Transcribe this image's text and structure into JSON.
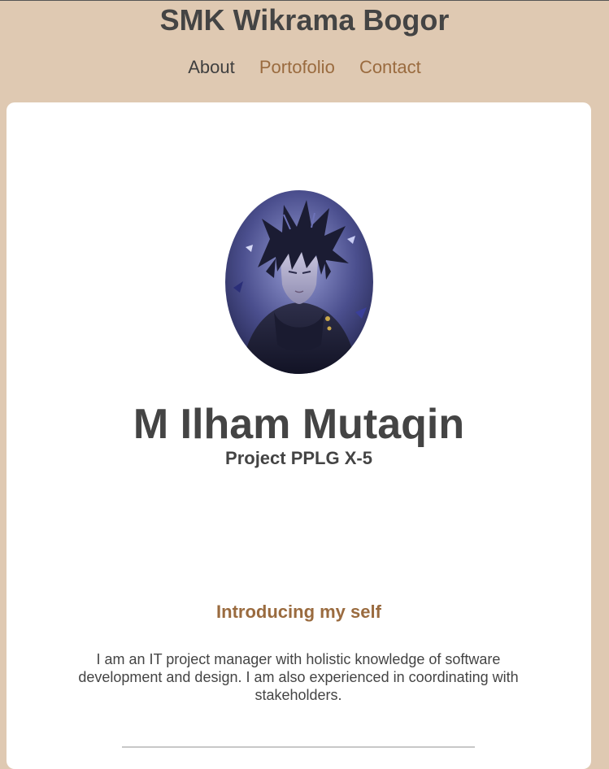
{
  "header": {
    "site_title": "SMK Wikrama Bogor",
    "nav": [
      {
        "label": "About"
      },
      {
        "label": "Portofolio"
      },
      {
        "label": "Contact"
      }
    ]
  },
  "profile": {
    "name": "M Ilham Mutaqin",
    "role": "Project PPLG X-5"
  },
  "intro": {
    "heading": "Introducing my self",
    "text": "I am an IT project manager with holistic knowledge of software development and design. I am also experienced in coordinating with stakeholders."
  },
  "colors": {
    "page_background": "#dfc9b2",
    "card_background": "#ffffff",
    "text": "#444444",
    "accent": "#9a6b3f"
  }
}
